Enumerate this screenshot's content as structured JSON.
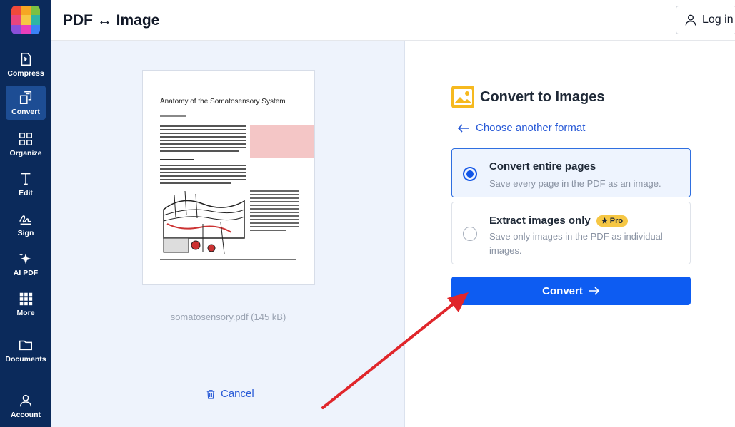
{
  "sidebar": {
    "items": [
      {
        "label": "Compress",
        "icon": "compress-icon"
      },
      {
        "label": "Convert",
        "icon": "convert-icon",
        "active": true
      },
      {
        "label": "Organize",
        "icon": "organize-icon"
      },
      {
        "label": "Edit",
        "icon": "edit-text-icon"
      },
      {
        "label": "Sign",
        "icon": "signature-icon"
      },
      {
        "label": "AI PDF",
        "icon": "sparkle-icon"
      },
      {
        "label": "More",
        "icon": "grid-dots-icon"
      },
      {
        "label": "Documents",
        "icon": "folder-icon"
      },
      {
        "label": "Account",
        "icon": "user-icon"
      }
    ]
  },
  "header": {
    "title": "PDF ↔ Image",
    "login_label": "Log in"
  },
  "preview": {
    "doc_title": "Anatomy of the Somatosensory System",
    "filename": "somatosensory.pdf (145 kB)",
    "cancel_label": "Cancel"
  },
  "convert_panel": {
    "title": "Convert to Images",
    "choose_link": "Choose another format",
    "options": [
      {
        "title": "Convert entire pages",
        "description": "Save every page in the PDF as an image.",
        "selected": true
      },
      {
        "title": "Extract images only",
        "badge": "Pro",
        "description": "Save only images in the PDF as individual images.",
        "selected": false
      }
    ],
    "button_label": "Convert"
  },
  "colors": {
    "sidebar_bg": "#0b2a5b",
    "accent": "#0d5cf2",
    "annotation_arrow": "#e0262b",
    "pro_badge": "#f6c744"
  }
}
